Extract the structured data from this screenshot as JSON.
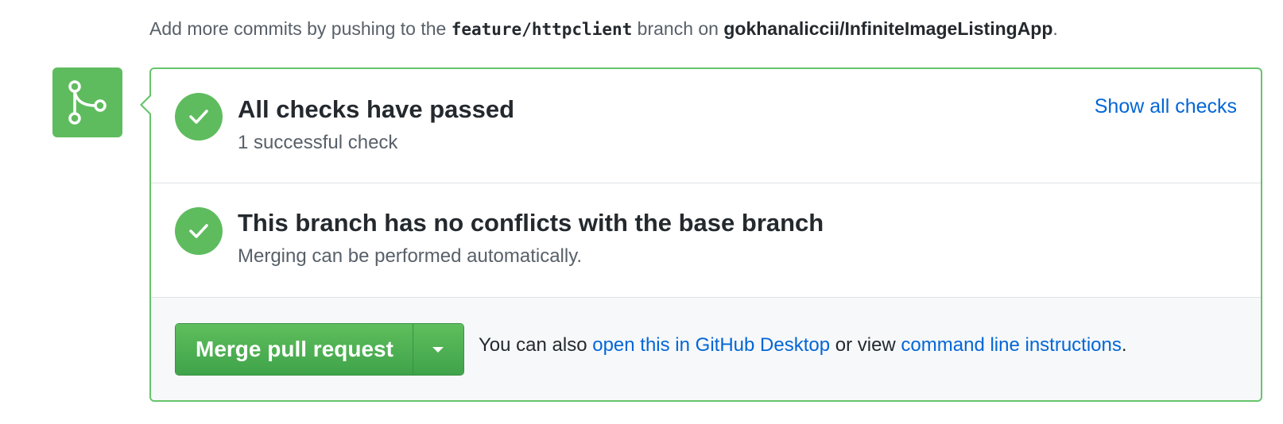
{
  "hint": {
    "prefix": "Add more commits by pushing to the ",
    "branch": "feature/httpclient",
    "middle": " branch on ",
    "repo": "gokhanaliccii/InfiniteImageListingApp",
    "suffix": "."
  },
  "merge_icon": "git-merge-icon",
  "checks": {
    "title": "All checks have passed",
    "subtitle": "1 successful check",
    "show_all": "Show all checks"
  },
  "conflicts": {
    "title": "This branch has no conflicts with the base branch",
    "subtitle": "Merging can be performed automatically."
  },
  "merge": {
    "button_label": "Merge pull request",
    "dropdown_icon": "caret-down-icon",
    "also_prefix": "You can also ",
    "desktop_link": "open this in GitHub Desktop",
    "also_middle": " or view ",
    "cli_link": "command line instructions",
    "also_suffix": "."
  },
  "colors": {
    "success": "#5ebc5e",
    "border": "#67c46b",
    "link": "#0366d6"
  }
}
